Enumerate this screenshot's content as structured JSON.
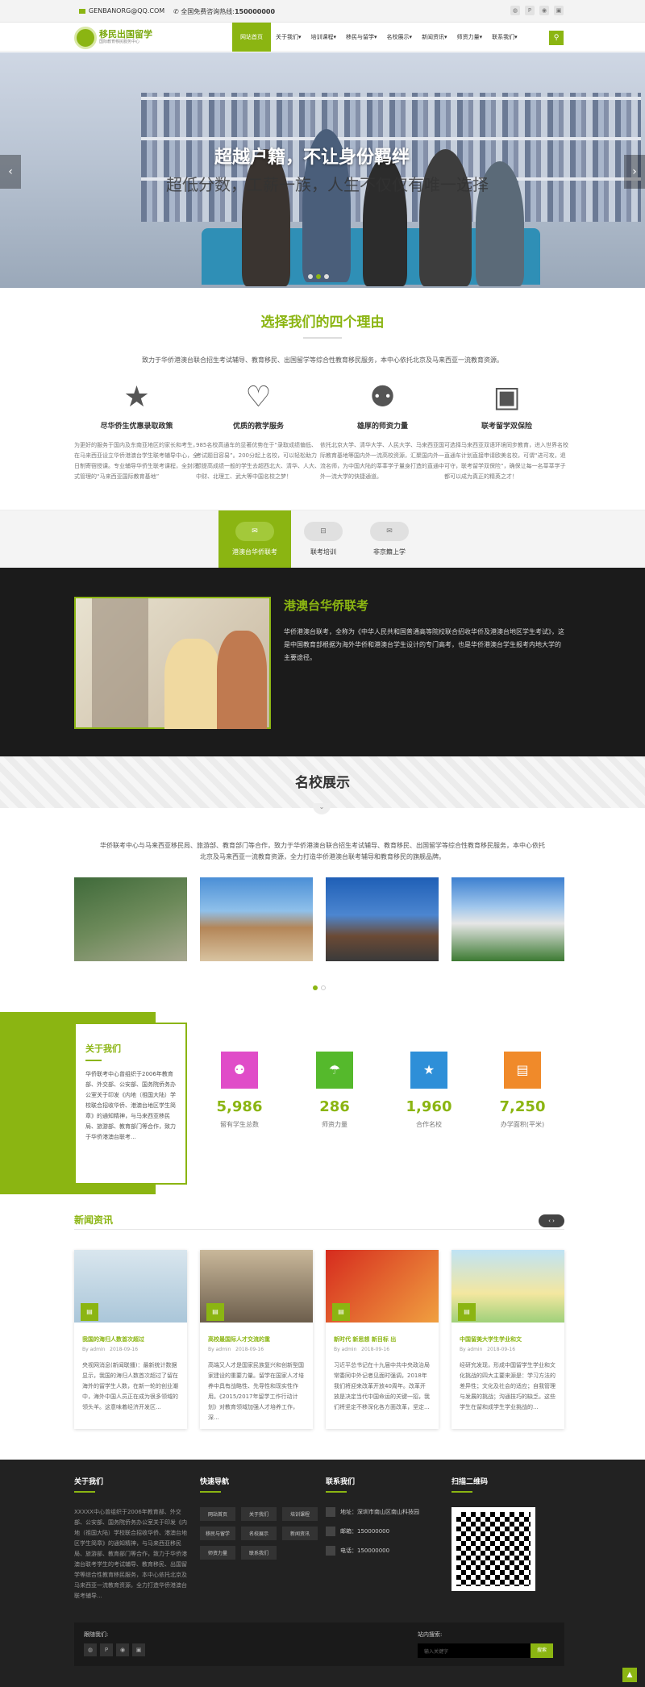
{
  "topbar": {
    "email": "GENBANORG@QQ.COM",
    "hotline": "全国免费咨询热线:",
    "phone": "150000000",
    "icons": [
      "weibo-icon",
      "p-icon",
      "qq-icon",
      "cart-icon"
    ]
  },
  "header": {
    "logo_title": "移民出国留学",
    "logo_sub": "国际教育移民服务中心",
    "nav": [
      "网站首页",
      "关于我们▾",
      "培训课程▾",
      "移民与留学▾",
      "名校展示▾",
      "新闻资讯▾",
      "师资力量▾",
      "联系我们▾"
    ],
    "search": "⚲"
  },
  "hero": {
    "title": "超越户籍，不让身份羁绊",
    "subtitle": "超低分数，工薪一族，人生不仅仅有唯一选择"
  },
  "reasons": {
    "title": "选择我们的四个理由",
    "intro": "致力于华侨港澳台联合招生考试辅导、教育移民、出国留学等综合性教育移民服务，本中心依托北京及马来西亚一流教育资源。",
    "items": [
      {
        "title": "尽华侨生优惠录取政策",
        "text": "为更好的服务于国内及东南亚地区的家长和考生，在马来西亚设立华侨港澳台学生联考辅导中心，全日制寄宿授课。专业辅导华侨生联考课程，全封闭式管理的“马来西亚国际教育基地”"
      },
      {
        "title": "优质的教学服务",
        "text": "985名校高通车的显著优势在于“录取成绩偏低、考试题目容易”。200分起上名校，可以轻松助力想提高成绩一般的学生去超西北大、清华、人大、中财、北理工、武大等中国名校之梦！"
      },
      {
        "title": "雄厚的师资力量",
        "text": "依托北京大学、清华大学、人民大学、马来西亚国际教育基地等国内外一流高校资源，汇聚国内外一流名师，为中国大陆的莘莘学子量身打造的直通中外一流大学的快捷通道。"
      },
      {
        "title": "联考留学双保险",
        "text": "可选择马来西亚双语环境同步教育，进入世界名校直通车计划直接申请欧美名校，可谓“进可攻，退可守，联考留学双保险”，确保让每一名莘莘学子都可以成为真正的精英之才！"
      }
    ]
  },
  "tabs": [
    {
      "label": "港澳台华侨联考",
      "icon": "✉"
    },
    {
      "label": "联考培训",
      "icon": "⊟"
    },
    {
      "label": "非京籍上学",
      "icon": "✉"
    }
  ],
  "feature": {
    "title": "港澳台华侨联考",
    "text": "华侨港澳台联考，全称为《中华人民共和国普通高等院校联合招收华侨及港澳台地区学生考试》，这是中国教育部根据为海外华侨和港澳台学生设计的专门高考，也是华侨港澳台学生报考内地大学的主要途径。"
  },
  "schools": {
    "title": "名校展示",
    "intro": "华侨联考中心与马来西亚移民局、旅游部、教育部门等合作，致力于华侨港澳台联合招生考试辅导、教育移民、出国留学等综合性教育移民服务，本中心依托北京及马来西亚一流教育资源，全力打造华侨港澳台联考辅导和教育移民的旗舰品牌。"
  },
  "about": {
    "title": "关于我们",
    "text": "华侨联考中心曾组织于2006年教育部、外交部、公安部、国务院侨务办公室关于印发《内地（祖国大陆）学校联合招收华侨、港澳台地区学生简章》的通知精神，与马来西亚移民局、旅游部、教育部门等合作，致力于华侨港澳台联考..."
  },
  "stats": [
    {
      "value": "5,986",
      "label": "留有学生总数",
      "color": "#e04cc8",
      "icon": "⚉"
    },
    {
      "value": "286",
      "label": "师资力量",
      "color": "#55b92c",
      "icon": "☂"
    },
    {
      "value": "1,960",
      "label": "合作名校",
      "color": "#2e8fd8",
      "icon": "★"
    },
    {
      "value": "7,250",
      "label": "办学面积(平米)",
      "color": "#f08a2a",
      "icon": "▤"
    }
  ],
  "news": {
    "title": "新闻资讯",
    "cards": [
      {
        "title": "我国的海归人数首次超过",
        "by": "By",
        "author": "admin",
        "date": "2018-09-16",
        "text": "央视网消息(新闻联播)：最新统计数据显示，我国的海归人数首次超过了留在海外的留学生人数，在新一轮的创业潮中，海外中国人员正在成为很多领域的领头羊。这意味着经济开发区..."
      },
      {
        "title": "高校最国际人才交流的重",
        "by": "By",
        "author": "admin",
        "date": "2018-09-16",
        "text": "高端又人才是国家民族复兴和创新型国家建设的重要力量。留学在国家人才培养中具有战略性、先导性和现实性作用。《2015/2017年留学工作行动计划》对教育领域加强人才培养工作，深..."
      },
      {
        "title": "新时代 新思想 新目标 出",
        "by": "By",
        "author": "admin",
        "date": "2018-09-16",
        "text": "习近平总书记在十九届中共中央政治局常委同中外记者见面时强调，2018年我们将迎来改革开放40周年。改革开放是决定当代中国命运的关键一招，我们将坚定不移深化各方面改革，坚定..."
      },
      {
        "title": "中国留美大学生学业和文",
        "by": "By",
        "author": "admin",
        "date": "2018-09-16",
        "text": "经研究发现，形成中国留学生学业和文化挑战的四大主要来源是：学习方法的差异性；文化及社会的适应；自我管理与发展的挑战；沟通技巧的缺乏。这些学生在留和成学生学业挑战的..."
      }
    ]
  },
  "footer": {
    "about_title": "关于我们",
    "about_text": "XXXXX中心曾组织于2006年教育部、外交部、公安部、国务院侨务办公室关于印发《内地（祖国大陆）学校联合招收华侨、港澳台地区学生简章》的通知精神，与马来西亚移民局、旅游部、教育部门等合作，致力于华侨港澳台联考学生的考试辅导、教育移民、出国留学等综合性教育移民服务，本中心依托北京及马来西亚一流教育资源，全力打造华侨港澳台联考辅导...",
    "nav_title": "快速导航",
    "nav": [
      "网站首页",
      "关于我们",
      "培训课程",
      "移民与留学",
      "名校展示",
      "新闻资讯",
      "师资力量",
      "联系我们"
    ],
    "contact_title": "联系我们",
    "address_label": "地址：",
    "address": "深圳市南山区南山科技园",
    "email_label": "邮箱：",
    "email": "150000000",
    "phone_label": "电话：",
    "phone": "150000000",
    "qr_title": "扫描二维码",
    "follow_label": "跟随我们:",
    "search_label": "站内搜索:",
    "search_placeholder": "输入关键字",
    "search_btn": "搜索"
  }
}
